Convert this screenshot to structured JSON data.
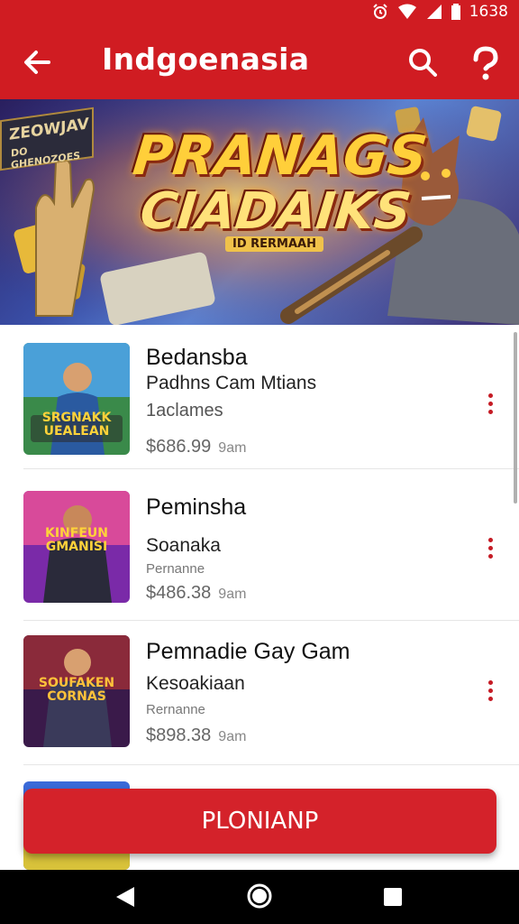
{
  "status_bar": {
    "time": "1638",
    "icons": [
      "alarm-icon",
      "wifi-icon",
      "signal-icon",
      "battery-icon"
    ]
  },
  "app_bar": {
    "title": "Indgoenasia",
    "icons": [
      "back-arrow-icon",
      "search-icon",
      "help-icon"
    ],
    "color": "#d01c22"
  },
  "banner": {
    "tag_line1": "ZEOWJAV",
    "tag_line2": "DO GHENOZOES",
    "title_line1": "PRANAGS",
    "title_line2": "CIADAIKS",
    "subtitle": "ID RERMAAH"
  },
  "list": [
    {
      "title": "Bedansba",
      "subtitle": "Padhns Cam Mtians",
      "meta": "1aclames",
      "price": "$686.99",
      "unit": "9am",
      "thumb_text": "SRGNAKK UEALEAN"
    },
    {
      "title": "Peminsha",
      "subtitle": "Soanaka",
      "meta": "Pernanne",
      "price": "$486.38",
      "unit": "9am",
      "thumb_text": "KINFEUN GMANISI"
    },
    {
      "title": "Pemnadie Gay Gam",
      "subtitle": "Kesoakiaan",
      "meta": "Rernanne",
      "price": "$898.38",
      "unit": "9am",
      "thumb_text": "SOUFAKEN CORNAS"
    }
  ],
  "cta": {
    "label": "PLONIANP"
  },
  "nav_bar": {
    "icons": [
      "back-triangle-icon",
      "home-circle-icon",
      "recent-square-icon"
    ]
  }
}
